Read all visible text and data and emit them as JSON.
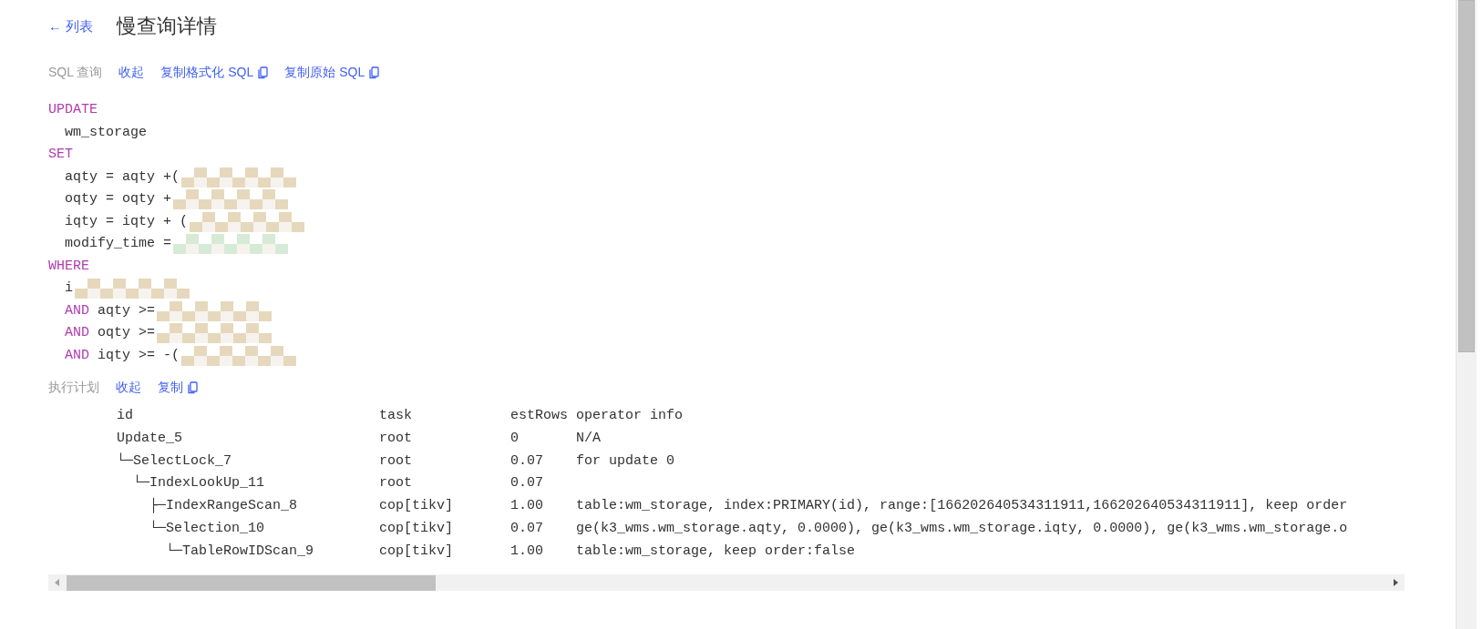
{
  "header": {
    "back_link": "← 列表",
    "title": "慢查询详情"
  },
  "sql_section": {
    "label": "SQL 查询",
    "actions": [
      {
        "text": "收起",
        "icon": false
      },
      {
        "text": "复制格式化 SQL",
        "icon": true
      },
      {
        "text": "复制原始 SQL",
        "icon": true
      }
    ],
    "clauses": [
      {
        "keyword": "UPDATE",
        "lines": [
          {
            "text": "wm_storage"
          }
        ]
      },
      {
        "keyword": "SET",
        "lines": [
          {
            "text": "aqty = aqty +(",
            "redacted": true,
            "color": "#e6d8bc"
          },
          {
            "text": "oqty = oqty +",
            "redacted": true,
            "color": "#e6d8bc"
          },
          {
            "text": "iqty = iqty + (",
            "redacted": true,
            "color": "#e6d8bc"
          },
          {
            "text": "modify_time =",
            "redacted": true,
            "color": "#d6ebd6"
          }
        ]
      },
      {
        "keyword": "WHERE",
        "lines": [
          {
            "text": "i",
            "redacted": true,
            "color": "#e6d8bc"
          },
          {
            "keyword": "AND",
            "text": "aqty >=",
            "redacted": true,
            "color": "#e6d8bc"
          },
          {
            "keyword": "AND",
            "text": "oqty >=",
            "redacted": true,
            "color": "#e6d8bc"
          },
          {
            "keyword": "AND",
            "text": "iqty >= -(",
            "redacted": true,
            "color": "#e6d8bc"
          }
        ]
      }
    ]
  },
  "plan_section": {
    "label": "执行计划",
    "actions": [
      {
        "text": "收起",
        "icon": false
      },
      {
        "text": "复制",
        "icon": true
      }
    ],
    "columns": [
      "id",
      "task",
      "estRows",
      "operator info"
    ],
    "rows": [
      {
        "id": "Update_5",
        "task": "root",
        "estRows": "0",
        "operator_info": "N/A",
        "children": [
          {
            "id": "└─SelectLock_7",
            "task": "root",
            "estRows": "0.07",
            "operator_info": "for update 0",
            "children": [
              {
                "id": "└─IndexLookUp_11",
                "task": "root",
                "estRows": "0.07",
                "children": [
                  {
                    "id": "├─IndexRangeScan_8",
                    "task": "cop[tikv]",
                    "estRows": "1.00",
                    "operator_info": "table:wm_storage, index:PRIMARY(id), range:[166202640534311911,166202640534311911], keep order"
                  },
                  {
                    "id": "└─Selection_10",
                    "task": "cop[tikv]",
                    "estRows": "0.07",
                    "operator_info": "ge(k3_wms.wm_storage.aqty, 0.0000), ge(k3_wms.wm_storage.iqty, 0.0000), ge(k3_wms.wm_storage.o",
                    "children": [
                      {
                        "id": "└─TableRowIDScan_9",
                        "task": "cop[tikv]",
                        "estRows": "1.00",
                        "operator_info": "table:wm_storage, keep order:false"
                      }
                    ]
                  }
                ]
              }
            ]
          }
        ]
      }
    ]
  }
}
